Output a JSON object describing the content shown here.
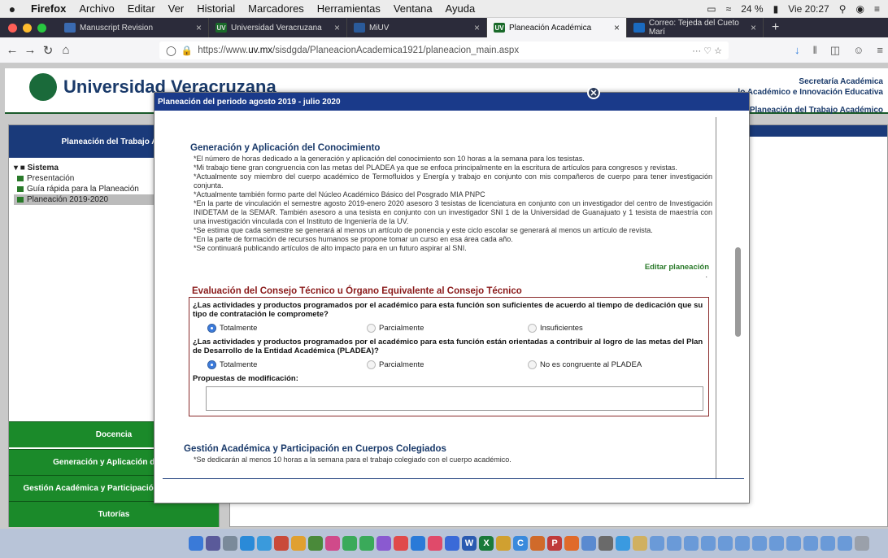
{
  "menubar": {
    "apple": "",
    "items": [
      "Firefox",
      "Archivo",
      "Editar",
      "Ver",
      "Historial",
      "Marcadores",
      "Herramientas",
      "Ventana",
      "Ayuda"
    ],
    "battery": "24 %",
    "clock": "Vie 20:27"
  },
  "tabs": [
    {
      "label": "Manuscript Revision",
      "fav": "",
      "favbg": "#3a6ab0"
    },
    {
      "label": "Universidad Veracruzana",
      "fav": "UV",
      "favbg": "#1a6a2a"
    },
    {
      "label": "MiUV",
      "fav": "",
      "favbg": "#2a5a9a"
    },
    {
      "label": "Planeación Académica",
      "fav": "UV",
      "favbg": "#1a6a2a"
    },
    {
      "label": "Correo: Tejeda del Cueto Marí",
      "fav": "",
      "favbg": "#1a6ac0"
    }
  ],
  "active_tab": 3,
  "url": {
    "prefix": "https://www.",
    "domain": "uv.mx",
    "path": "/sisdgda/PlaneacionAcademica1921/planeacion_main.aspx",
    "extra": "··· ♡ ☆"
  },
  "header": {
    "university": "Universidad Veracruzana",
    "sec_line1": "Secretaría Académica",
    "sec_line2": "lo Académico e Innovación Educativa",
    "sec_line3": "Planeación del Trabajo Académico"
  },
  "left": {
    "title": "Planeación del Trabajo Aca",
    "root": "Sistema",
    "items": [
      "Presentación",
      "Guía rápida para la Planeación",
      "Planeación 2019-2020"
    ],
    "buttons": [
      "Docencia",
      "Generación y Aplicación del Co",
      "Gestión Académica y Participación Colegiados",
      "Tutorías"
    ]
  },
  "modal": {
    "title": "Planeación del periodo agosto 2019 - julio 2020",
    "close": "✕",
    "gac_heading": "Generación y Aplicación del Conocimiento",
    "gac_lines": [
      "*El número de horas dedicado a la generación y aplicación del conocimiento son 10 horas a la semana para los tesistas.",
      "*Mi trabajo tiene gran congruencia con las metas del PLADEA ya que se enfoca principalmente en la escritura de artículos para congresos y revistas.",
      "*Actualmente soy miembro del cuerpo académico de Termofluidos y Energía y trabajo en conjunto con mis compañeros de cuerpo para tener investigación conjunta.",
      "*Actualmente también formo parte del Núcleo Académico Básico del Posgrado MIA PNPC",
      "*En la parte de vinculación el semestre agosto 2019-enero 2020 asesoro 3 tesistas de licenciatura en conjunto con un investigador del centro de Investigación INIDETAM de la SEMAR. También asesoro a una tesista en conjunto con un investigador SNI 1 de la Universidad de Guanajuato y 1 tesista de maestría con una investigación vinculada con el Instituto de Ingeniería de la UV.",
      "*Se estima que cada semestre se generará al menos un artículo de ponencia y este ciclo escolar se generará al menos un artículo de revista.",
      "*En la parte de formación de recursos humanos se propone tomar un curso en esa área cada año.",
      "*Se continuará publicando artículos de alto impacto para en un futuro aspirar al SNI."
    ],
    "edit_link": "Editar planeación",
    "dot": ".",
    "eval_heading": "Evaluación del Consejo Técnico u Órgano Equivalente al Consejo Técnico",
    "q1": "¿Las actividades y productos programados por el académico para esta función son suficientes de acuerdo al tiempo de dedicación que su tipo de contratación le compromete?",
    "q1_opts": [
      "Totalmente",
      "Parcialmente",
      "Insuficientes"
    ],
    "q2": "¿Las actividades y productos programados por el académico para esta función están orientadas a contribuir al logro de las metas del Plan de Desarrollo de la Entidad Académica (PLADEA)?",
    "q2_opts": [
      "Totalmente",
      "Parcialmente",
      "No es congruente al PLADEA"
    ],
    "proposals_label": "Propuestas de modificación:",
    "gestion_heading": "Gestión Académica y Participación en Cuerpos Colegiados",
    "gestion_line": "*Se dedicarán al menos 10 horas a la semana para el trabajo colegiado con el cuerpo académico."
  }
}
